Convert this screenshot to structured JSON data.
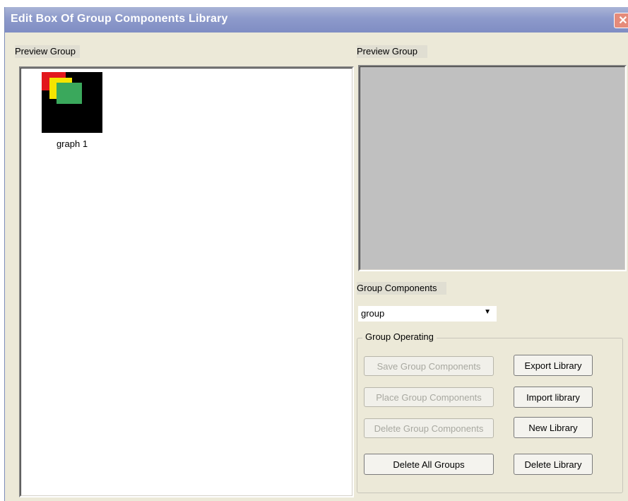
{
  "window": {
    "title": "Edit Box Of Group Components Library",
    "close_glyph": "✕"
  },
  "left_panel": {
    "label": "Preview Group",
    "items": [
      {
        "caption": "graph 1"
      }
    ]
  },
  "right_panel": {
    "preview_label": "Preview Group",
    "components_label": "Group Components",
    "combo": {
      "value": "group",
      "arrow": "▼"
    }
  },
  "group_operating": {
    "title": "Group Operating",
    "buttons": {
      "save": "Save Group Components",
      "place": "Place Group Components",
      "delete": "Delete Group Components",
      "delete_all": "Delete All Groups",
      "export": "Export Library",
      "import": "Import library",
      "new": "New Library",
      "delete_library": "Delete Library"
    }
  },
  "colors": {
    "thumb_bg": "#000000",
    "square_red": "#e2171c",
    "square_yellow": "#f5e400",
    "square_green": "#3aa85c",
    "preview_bg": "#c0c0c0"
  }
}
